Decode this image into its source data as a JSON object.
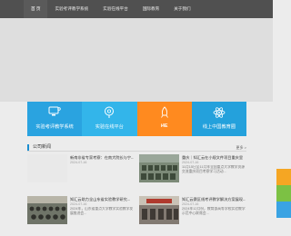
{
  "nav": {
    "items": [
      {
        "label": "首  页",
        "active": true
      },
      {
        "label": "实验考评教学系统",
        "active": false
      },
      {
        "label": "实验在线平台",
        "active": false
      },
      {
        "label": "国际教育",
        "active": false
      },
      {
        "label": "关于我们",
        "active": false
      }
    ]
  },
  "tiles": [
    {
      "label": "实验考评教学系统",
      "color": "#2aa3e0",
      "icon": "computer-icon"
    },
    {
      "label": "实验在线平台",
      "color": "#33b5ea",
      "icon": "location-pin-icon"
    },
    {
      "label": "i4E",
      "color": "#ff8a1f",
      "icon": "rocket-icon"
    },
    {
      "label": "线上中国教育圈",
      "color": "#24a1dc",
      "icon": "atom-icon"
    }
  ],
  "news_section": {
    "title": "公司新闻",
    "more": "更多 >"
  },
  "news": [
    {
      "title": "新南非省专家考察：在南大院长与宁...",
      "date": "2024-07-16",
      "summary": ""
    },
    {
      "title": "重庆｜知汇云在小规文件项目重庆里",
      "date": "2024-07-16",
      "summary": "11月15日至11月年全国重点大学教学资源交流重庆项目考察学习活动..."
    },
    {
      "title": "知汇云助力全山东省实验教学研究...",
      "date": "2024-07-16",
      "summary": "2024年，山东省重点大学教学实验教学发展推进会..."
    },
    {
      "title": "知汇云赛区线考评教学解决方案展现...",
      "date": "2024-07-16",
      "summary": "2024年12月份，教育部高等学校实验教学示范中心联席会..."
    }
  ],
  "sidebar": [
    {
      "color": "#f5a623"
    },
    {
      "color": "#7cc144"
    },
    {
      "color": "#3aa3e3"
    }
  ]
}
